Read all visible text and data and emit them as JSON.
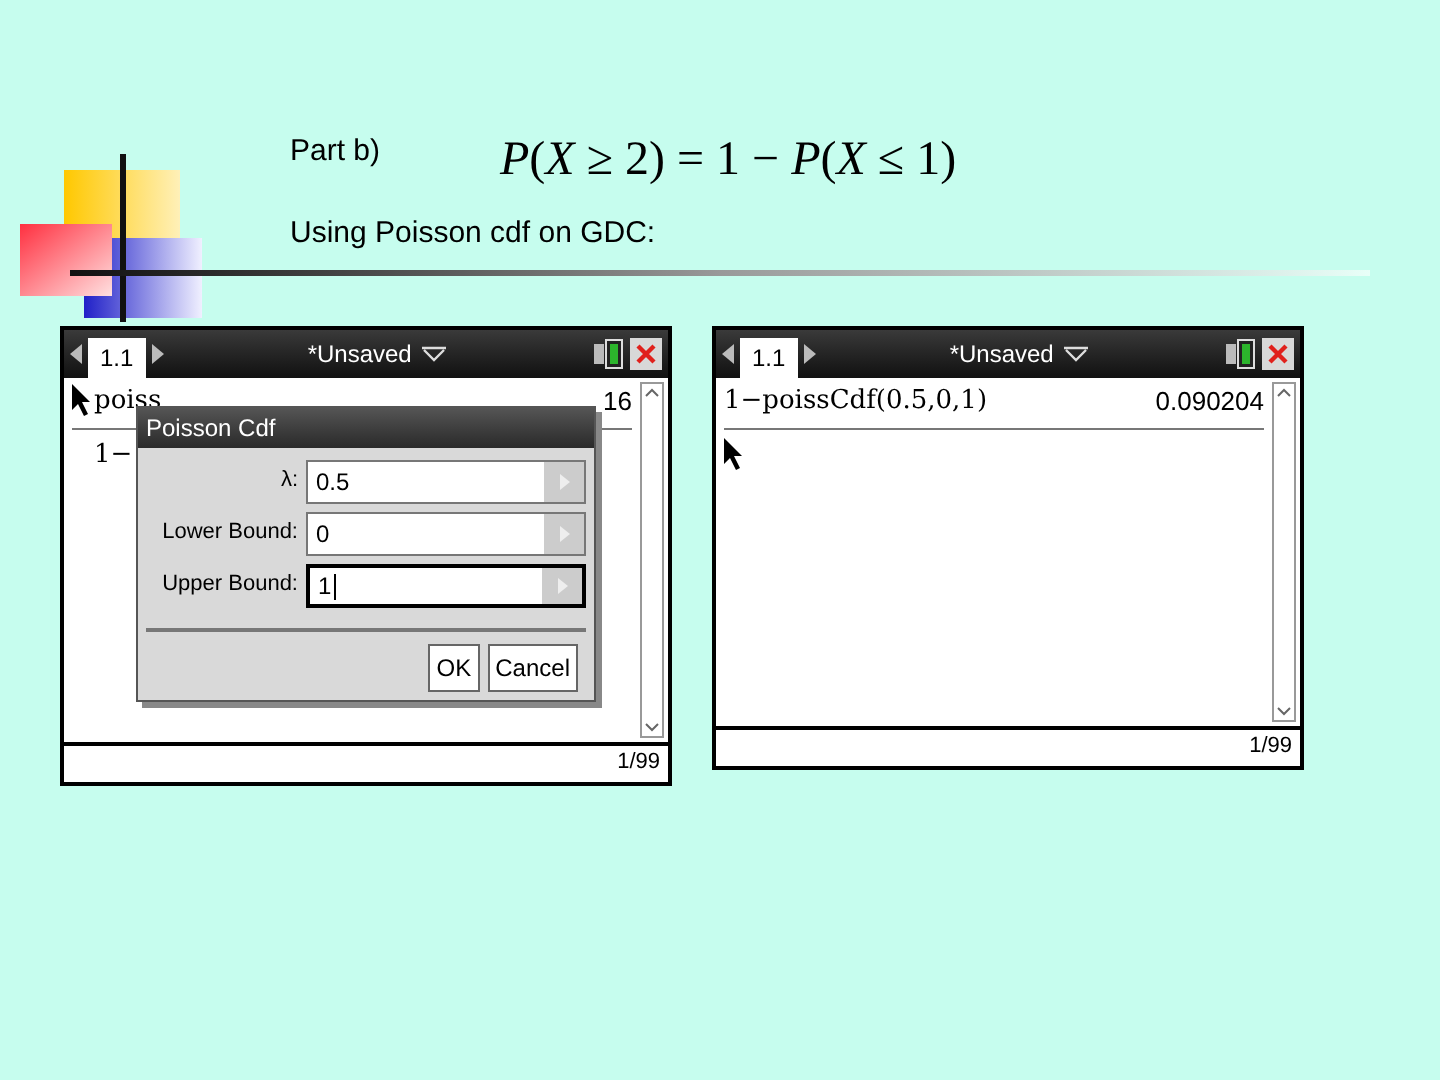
{
  "slide": {
    "heading": "Part b)",
    "formula": "*P*(*X* ≥ 2) = 1 − *P*(*X* ≤ 1)",
    "subheading": "Using Poisson cdf on GDC:"
  },
  "screens": [
    {
      "tab": "1.1",
      "doc_title": "*Unsaved",
      "entries": [
        {
          "expression": "poiss",
          "result": "16"
        },
        {
          "expression": "1−"
        }
      ],
      "dialog": {
        "title": "Poisson Cdf",
        "fields": [
          {
            "label": "λ:",
            "value": "0.5",
            "focused": false
          },
          {
            "label": "Lower Bound:",
            "value": "0",
            "focused": false
          },
          {
            "label": "Upper Bound:",
            "value": "1",
            "focused": true
          }
        ],
        "buttons": [
          "OK",
          "Cancel"
        ]
      },
      "page_indicator": "1/99"
    },
    {
      "tab": "1.1",
      "doc_title": "*Unsaved",
      "entries": [
        {
          "expression": "1−poissCdf(0.5,0,1)",
          "result": "0.090204"
        }
      ],
      "page_indicator": "1/99"
    }
  ]
}
